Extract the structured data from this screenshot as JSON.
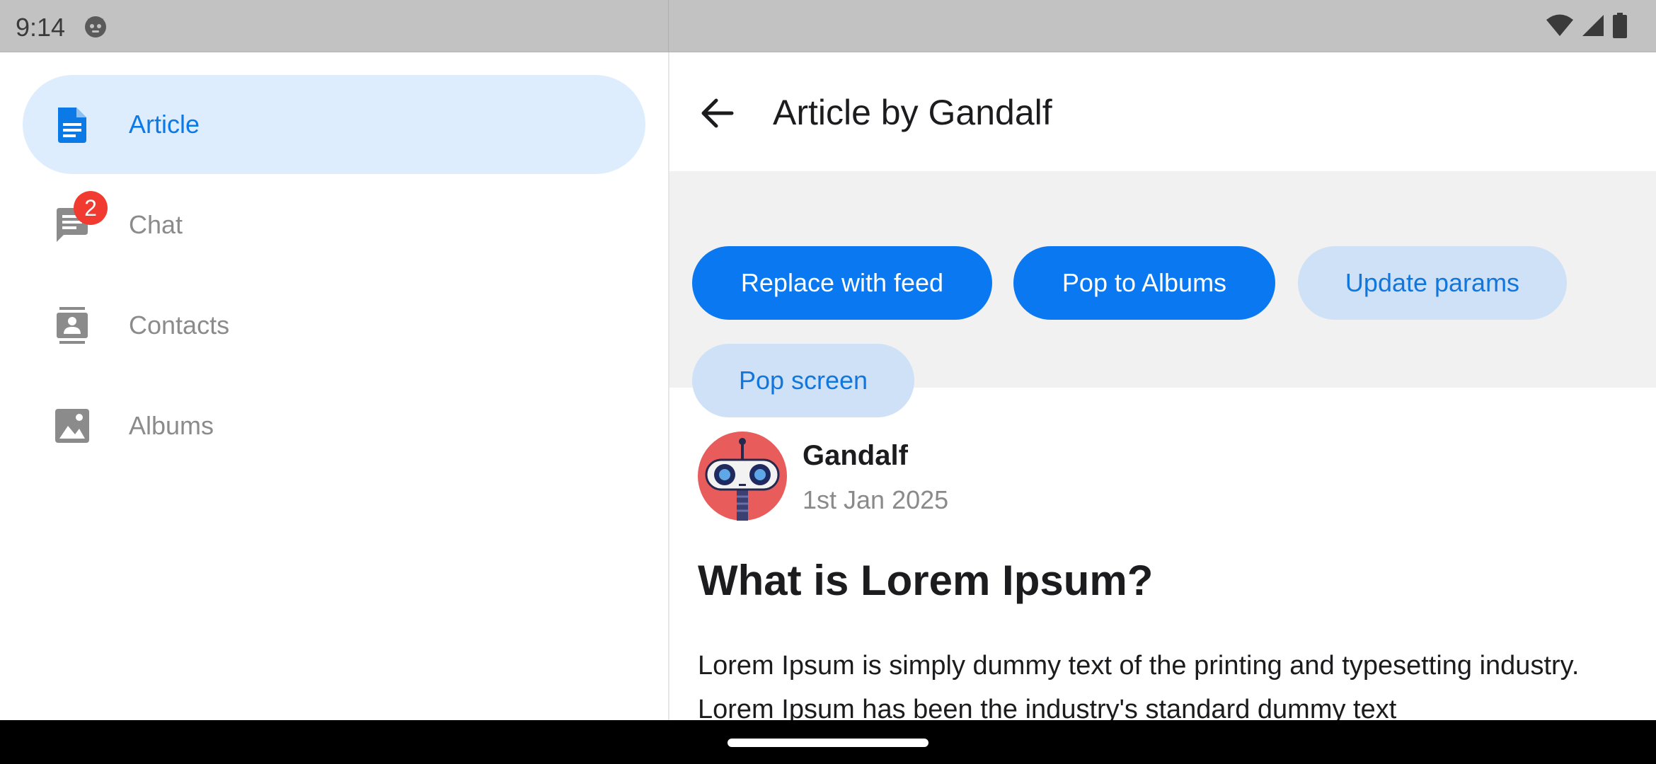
{
  "status_bar": {
    "time": "9:14",
    "icons": [
      "cat-icon",
      "wifi-icon",
      "signal-icon",
      "battery-icon"
    ]
  },
  "sidebar": {
    "items": [
      {
        "label": "Article",
        "icon": "article-icon",
        "active": true
      },
      {
        "label": "Chat",
        "icon": "chat-icon",
        "badge": "2"
      },
      {
        "label": "Contacts",
        "icon": "contacts-icon"
      },
      {
        "label": "Albums",
        "icon": "albums-icon"
      }
    ]
  },
  "header": {
    "title": "Article by Gandalf",
    "back_icon": "back-arrow-icon"
  },
  "actions": {
    "replace_with_feed": "Replace with feed",
    "pop_to_albums": "Pop to Albums",
    "update_params": "Update params",
    "pop_screen": "Pop screen"
  },
  "article": {
    "author_name": "Gandalf",
    "date": "1st Jan 2025",
    "title": "What is Lorem Ipsum?",
    "body": "Lorem Ipsum is simply dummy text of the printing and typesetting industry. Lorem Ipsum has been the industry's standard dummy text"
  },
  "colors": {
    "accent": "#0a78f0",
    "active_nav_bg": "#deedfd",
    "secondary_chip_bg": "#cfe1f6",
    "badge": "#f23b30"
  }
}
